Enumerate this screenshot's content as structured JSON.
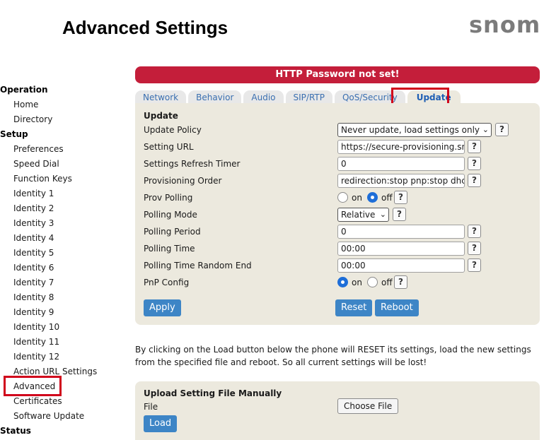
{
  "header": {
    "title": "Advanced Settings",
    "logo_text": "snom"
  },
  "alert": {
    "text": "HTTP Password not set!"
  },
  "sidebar": {
    "groups": [
      {
        "label": "Operation",
        "items": [
          "Home",
          "Directory"
        ]
      },
      {
        "label": "Setup",
        "items": [
          "Preferences",
          "Speed Dial",
          "Function Keys",
          "Identity 1",
          "Identity 2",
          "Identity 3",
          "Identity 4",
          "Identity 5",
          "Identity 6",
          "Identity 7",
          "Identity 8",
          "Identity 9",
          "Identity 10",
          "Identity 11",
          "Identity 12",
          "Action URL Settings",
          "Advanced",
          "Certificates",
          "Software Update"
        ]
      },
      {
        "label": "Status",
        "items": []
      }
    ],
    "active_item": "Advanced"
  },
  "tabs": [
    "Network",
    "Behavior",
    "Audio",
    "SIP/RTP",
    "QoS/Security",
    "Update"
  ],
  "active_tab": "Update",
  "update": {
    "section_title": "Update",
    "fields": {
      "update_policy": {
        "label": "Update Policy",
        "value": "Never update, load settings only"
      },
      "setting_url": {
        "label": "Setting URL",
        "value": "https://secure-provisioning.snom"
      },
      "refresh_timer": {
        "label": "Settings Refresh Timer",
        "value": "0"
      },
      "prov_order": {
        "label": "Provisioning Order",
        "value": "redirection:stop pnp:stop dhcp:stop"
      },
      "prov_polling": {
        "label": "Prov Polling",
        "on": "on",
        "off": "off",
        "selected": "off"
      },
      "polling_mode": {
        "label": "Polling Mode",
        "value": "Relative"
      },
      "polling_period": {
        "label": "Polling Period",
        "value": "0"
      },
      "polling_time": {
        "label": "Polling Time",
        "value": "00:00"
      },
      "polling_random_end": {
        "label": "Polling Time Random End",
        "value": "00:00"
      },
      "pnp_config": {
        "label": "PnP Config",
        "on": "on",
        "off": "off",
        "selected": "on"
      }
    },
    "help_label": "?",
    "buttons": {
      "apply": "Apply",
      "reset": "Reset",
      "reboot": "Reboot"
    }
  },
  "info_text": "By clicking on the Load button below the phone will RESET its settings, load the new settings from the specified file and reboot. So all current settings will be lost!",
  "upload": {
    "title": "Upload Setting File Manually",
    "file_label": "File",
    "choose_file": "Choose File",
    "load": "Load"
  }
}
